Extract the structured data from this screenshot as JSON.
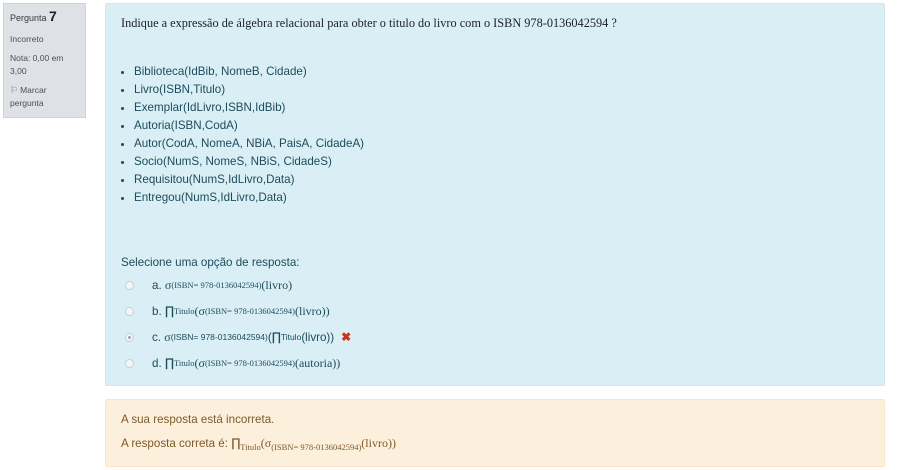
{
  "info": {
    "question_label": "Pergunta",
    "question_number": "7",
    "state": "Incorreto",
    "grade_line1": "Nota: 0,00 em",
    "grade_line2": "3,00",
    "flag_line1": "Marcar",
    "flag_line2": "pergunta",
    "flag_icon": "flag-icon"
  },
  "question": {
    "text": "Indique a expressão de álgebra relacional para obter o titulo do livro com o ISBN 978-0136042594 ?",
    "relations": [
      "Biblioteca(IdBib, NomeB, Cidade)",
      "Livro(ISBN,Titulo)",
      "Exemplar(IdLivro,ISBN,IdBib)",
      "Autoria(ISBN,CodA)",
      "Autor(CodA, NomeA, NBiA, PaisA, CidadeA)",
      "Socio(NumS, NomeS, NBiS, CidadeS)",
      "Requisitou(NumS,IdLivro,Data)",
      "Entregou(NumS,IdLivro,Data)"
    ],
    "prompt": "Selecione uma opção de resposta:"
  },
  "options": {
    "a": {
      "letter": "a.",
      "sigma": "σ",
      "sub": "(ISBN= 978-0136042594)",
      "arg": "(livro)"
    },
    "b": {
      "letter": "b.",
      "pi": "∏",
      "pi_sub": "Titulo",
      "open": "(",
      "sigma": "σ",
      "sub": "(ISBN= 978-0136042594)",
      "arg": "(livro))"
    },
    "c": {
      "letter": "c.",
      "sigma": "σ",
      "sub": "(ISBN= 978-0136042594)",
      "open": "(",
      "pi": "∏",
      "pi_sub": "Titulo",
      "arg": "(livro))",
      "selected": true
    },
    "d": {
      "letter": "d.",
      "pi": "∏",
      "pi_sub": "Titulo",
      "open": "(",
      "sigma": "σ",
      "sub": "(ISBN= 978-0136042594)",
      "arg": "(autoria))"
    },
    "incorrect_mark": "✖",
    "incorrect_color": "#ca3120"
  },
  "feedback": {
    "incorrect": "A sua resposta está incorreta.",
    "correct_prefix": "A resposta correta é: ",
    "pi": "∏",
    "pi_sub": "Titulo",
    "open": "(",
    "sigma": "σ",
    "sub": "(ISBN= 978-0136042594)",
    "arg": "(livro))"
  }
}
